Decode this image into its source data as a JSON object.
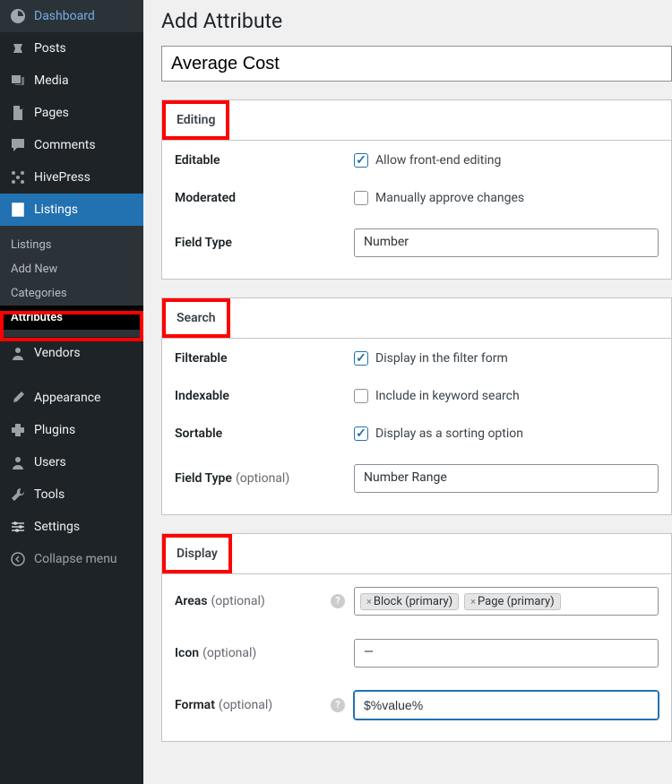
{
  "sidebar": {
    "items": [
      {
        "label": "Dashboard",
        "icon": "dashboard"
      },
      {
        "label": "Posts",
        "icon": "pin"
      },
      {
        "label": "Media",
        "icon": "media"
      },
      {
        "label": "Pages",
        "icon": "page"
      },
      {
        "label": "Comments",
        "icon": "comment"
      },
      {
        "label": "HivePress",
        "icon": "hivepress"
      },
      {
        "label": "Listings",
        "icon": "listings",
        "current": true
      },
      {
        "label": "Vendors",
        "icon": "user"
      },
      {
        "label": "Appearance",
        "icon": "brush"
      },
      {
        "label": "Plugins",
        "icon": "plugin"
      },
      {
        "label": "Users",
        "icon": "users"
      },
      {
        "label": "Tools",
        "icon": "wrench"
      },
      {
        "label": "Settings",
        "icon": "settings"
      },
      {
        "label": "Collapse menu",
        "icon": "collapse"
      }
    ],
    "submenu": [
      {
        "label": "Listings"
      },
      {
        "label": "Add New"
      },
      {
        "label": "Categories"
      },
      {
        "label": "Attributes",
        "current": true
      }
    ]
  },
  "page": {
    "title": "Add Attribute",
    "name_value": "Average Cost"
  },
  "editing": {
    "heading": "Editing",
    "editable_label": "Editable",
    "editable_check": "Allow front-end editing",
    "moderated_label": "Moderated",
    "moderated_check": "Manually approve changes",
    "fieldtype_label": "Field Type",
    "fieldtype_value": "Number"
  },
  "search": {
    "heading": "Search",
    "filterable_label": "Filterable",
    "filterable_check": "Display in the filter form",
    "indexable_label": "Indexable",
    "indexable_check": "Include in keyword search",
    "sortable_label": "Sortable",
    "sortable_check": "Display as a sorting option",
    "fieldtype_label": "Field Type",
    "fieldtype_optional": "(optional)",
    "fieldtype_value": "Number Range"
  },
  "display": {
    "heading": "Display",
    "areas_label": "Areas",
    "areas_optional": "(optional)",
    "areas_tags": [
      "Block (primary)",
      "Page (primary)"
    ],
    "icon_label": "Icon",
    "icon_optional": "(optional)",
    "icon_value": "—",
    "format_label": "Format",
    "format_optional": "(optional)",
    "format_value": "$%value%"
  }
}
